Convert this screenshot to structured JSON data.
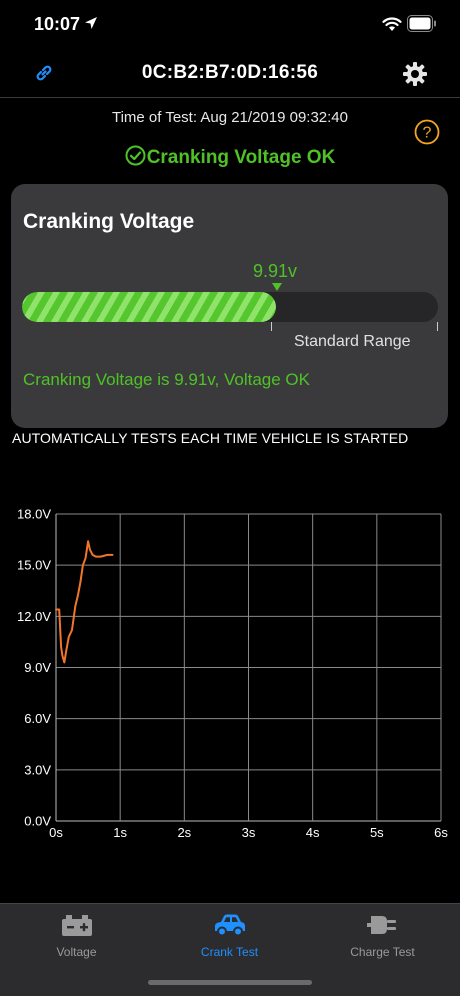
{
  "status_bar": {
    "time": "10:07"
  },
  "nav": {
    "title": "0C:B2:B7:0D:16:56"
  },
  "test_info": {
    "time_label": "Time of Test:",
    "time_value": "Aug 21/2019 09:32:40",
    "status": "Cranking Voltage OK"
  },
  "card": {
    "title": "Cranking Voltage",
    "reading": "9.91v",
    "fill_fraction": 0.61,
    "range_label": "Standard Range",
    "message": "Cranking Voltage is 9.91v, Voltage OK"
  },
  "auto_note": "AUTOMATICALLY TESTS EACH TIME VEHICLE IS STARTED",
  "chart_data": {
    "type": "line",
    "x_ticks": [
      "0s",
      "1s",
      "2s",
      "3s",
      "4s",
      "5s",
      "6s"
    ],
    "y_ticks": [
      "0.0V",
      "3.0V",
      "6.0V",
      "9.0V",
      "12.0V",
      "15.0V",
      "18.0V"
    ],
    "xlim": [
      0,
      6
    ],
    "ylim": [
      0,
      18
    ],
    "grid": true,
    "series": [
      {
        "color": "#f0772a",
        "x": [
          0,
          0.05,
          0.08,
          0.1,
          0.13,
          0.16,
          0.2,
          0.25,
          0.3,
          0.34,
          0.38,
          0.42,
          0.46,
          0.5,
          0.53,
          0.57,
          0.62,
          0.7,
          0.8,
          0.88
        ],
        "y": [
          12.4,
          12.4,
          10.2,
          9.7,
          9.3,
          10.0,
          10.8,
          11.2,
          12.6,
          13.2,
          14.0,
          15.0,
          15.4,
          16.4,
          15.9,
          15.6,
          15.5,
          15.5,
          15.6,
          15.6
        ]
      }
    ]
  },
  "tabs": [
    {
      "label": "Voltage",
      "icon": "battery-icon",
      "active": false
    },
    {
      "label": "Crank Test",
      "icon": "car-icon",
      "active": true
    },
    {
      "label": "Charge Test",
      "icon": "plug-icon",
      "active": false
    }
  ],
  "colors": {
    "ok_green": "#4fc227",
    "accent_blue": "#1e90ff",
    "line_orange": "#f0772a",
    "help_orange": "#f5a623"
  }
}
